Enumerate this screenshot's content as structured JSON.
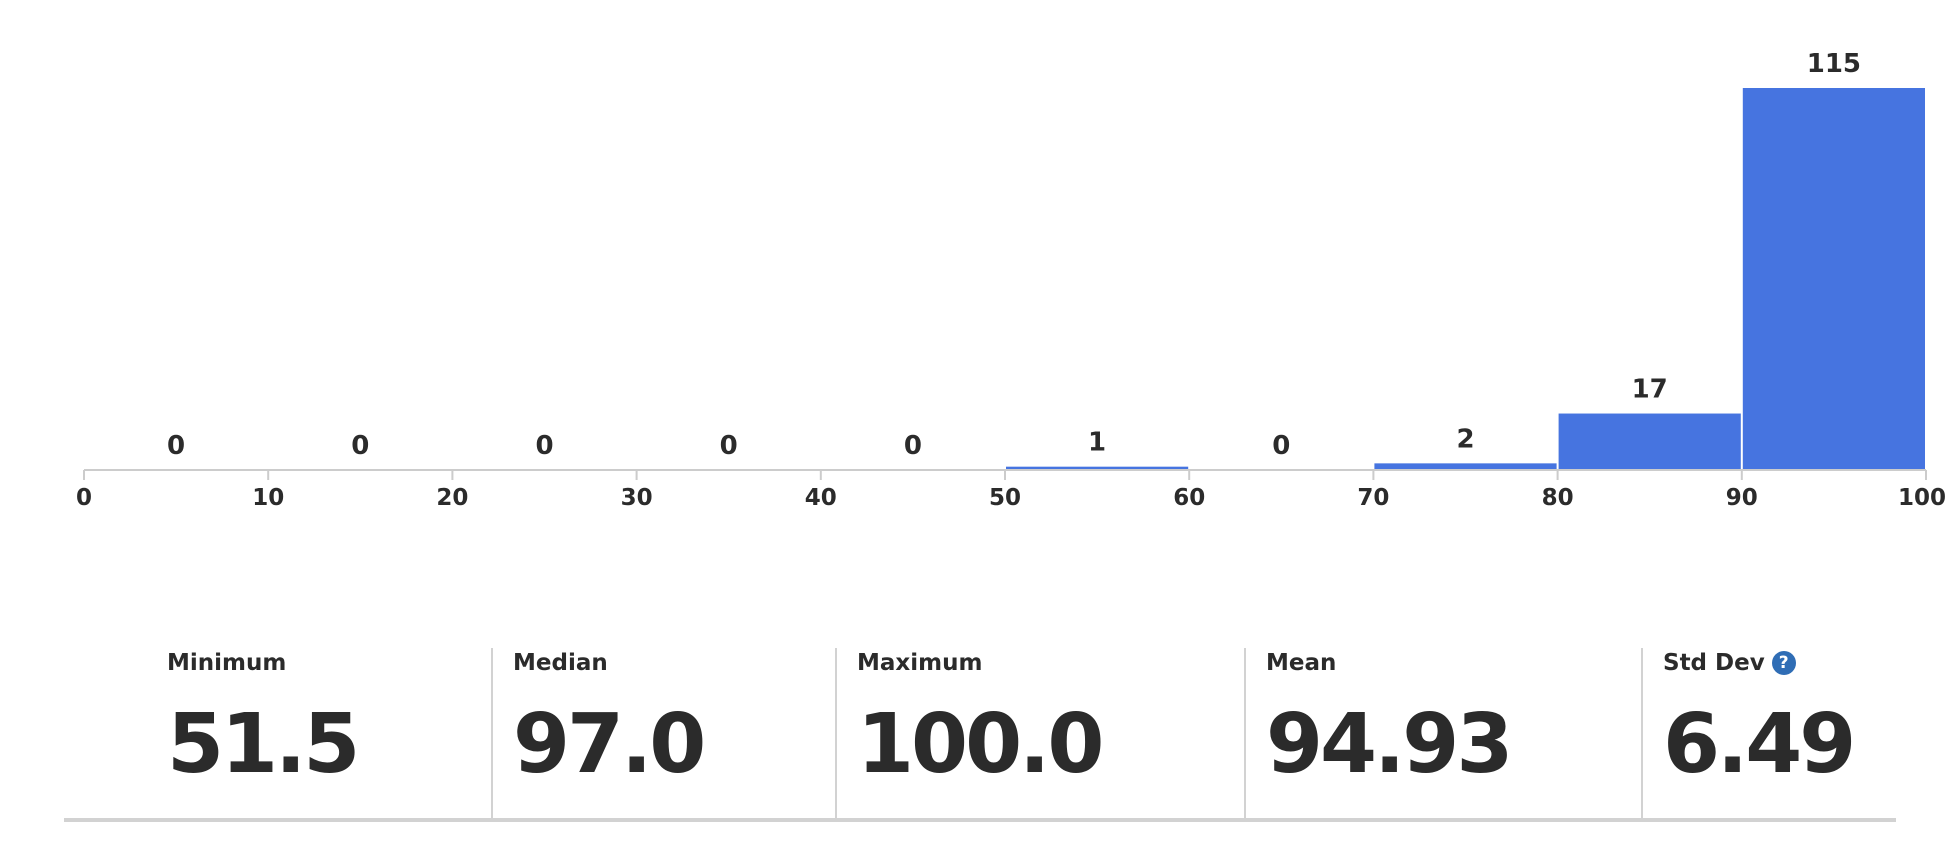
{
  "chart_data": {
    "type": "bar",
    "bins": [
      {
        "from": 0,
        "to": 10,
        "count": 0
      },
      {
        "from": 10,
        "to": 20,
        "count": 0
      },
      {
        "from": 20,
        "to": 30,
        "count": 0
      },
      {
        "from": 30,
        "to": 40,
        "count": 0
      },
      {
        "from": 40,
        "to": 50,
        "count": 0
      },
      {
        "from": 50,
        "to": 60,
        "count": 1
      },
      {
        "from": 60,
        "to": 70,
        "count": 0
      },
      {
        "from": 70,
        "to": 80,
        "count": 2
      },
      {
        "from": 80,
        "to": 90,
        "count": 17
      },
      {
        "from": 90,
        "to": 100,
        "count": 115
      }
    ],
    "x_ticks": [
      "0",
      "10",
      "20",
      "30",
      "40",
      "50",
      "60",
      "70",
      "80",
      "90",
      "100"
    ],
    "xlim": [
      0,
      100
    ],
    "ylim": [
      0,
      115
    ],
    "title": "",
    "xlabel": "",
    "ylabel": "",
    "grid": false,
    "bar_color": "#4674e0"
  },
  "stats": [
    {
      "label": "Minimum",
      "value": "51.5"
    },
    {
      "label": "Median",
      "value": "97.0"
    },
    {
      "label": "Maximum",
      "value": "100.0"
    },
    {
      "label": "Mean",
      "value": "94.93"
    },
    {
      "label": "Std Dev",
      "value": "6.49",
      "icon": "help-icon"
    }
  ],
  "colors": {
    "text": "#2b2b2b",
    "axis": "#cccccc",
    "divider": "#d2d2d2",
    "help_icon": "#2f6db5"
  }
}
